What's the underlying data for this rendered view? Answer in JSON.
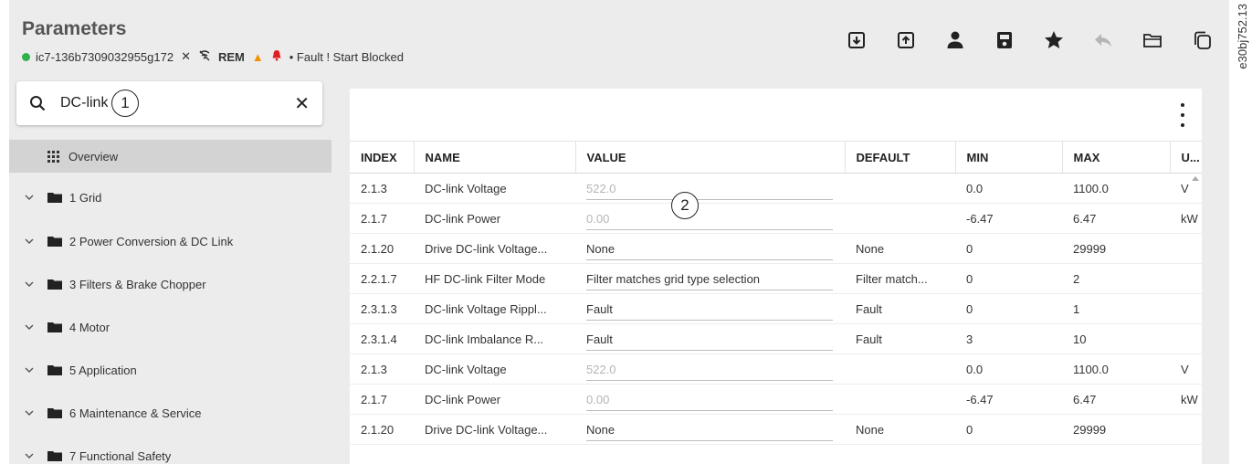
{
  "header": {
    "title": "Parameters",
    "device_id": "ic7-136b7309032955g172",
    "rem_label": "REM",
    "status_text": "• Fault ! Start Blocked",
    "status_color": "#2fb24a"
  },
  "watermark": "e30bj752.13",
  "toolbar": {
    "icons": [
      "download-icon",
      "upload-icon",
      "user-icon",
      "save-icon",
      "star-icon",
      "undo-icon",
      "folder-open-icon",
      "copy-icon"
    ]
  },
  "search": {
    "value": "DC-link",
    "callout": "1"
  },
  "sidebar": {
    "overview": "Overview",
    "items": [
      {
        "label": "1 Grid"
      },
      {
        "label": "2 Power Conversion & DC Link"
      },
      {
        "label": "3 Filters & Brake Chopper"
      },
      {
        "label": "4 Motor"
      },
      {
        "label": "5 Application"
      },
      {
        "label": "6 Maintenance & Service"
      },
      {
        "label": "7 Functional Safety"
      }
    ]
  },
  "table": {
    "callout": "2",
    "columns": [
      "INDEX",
      "NAME",
      "VALUE",
      "DEFAULT",
      "MIN",
      "MAX",
      "U..."
    ],
    "rows": [
      {
        "index": "2.1.3",
        "name": "DC-link Voltage",
        "value": "522.0",
        "muted": true,
        "default": "",
        "min": "0.0",
        "max": "1100.0",
        "unit": "V"
      },
      {
        "index": "2.1.7",
        "name": "DC-link Power",
        "value": "0.00",
        "muted": true,
        "default": "",
        "min": "-6.47",
        "max": "6.47",
        "unit": "kW"
      },
      {
        "index": "2.1.20",
        "name": "Drive DC-link Voltage...",
        "value": "None",
        "muted": false,
        "default": "None",
        "min": "0",
        "max": "29999",
        "unit": ""
      },
      {
        "index": "2.2.1.7",
        "name": "HF DC-link Filter Mode",
        "value": "Filter matches grid type selection",
        "muted": false,
        "default": "Filter match...",
        "min": "0",
        "max": "2",
        "unit": ""
      },
      {
        "index": "2.3.1.3",
        "name": "DC-link Voltage Rippl...",
        "value": "Fault",
        "muted": false,
        "default": "Fault",
        "min": "0",
        "max": "1",
        "unit": ""
      },
      {
        "index": "2.3.1.4",
        "name": "DC-link Imbalance R...",
        "value": "Fault",
        "muted": false,
        "default": "Fault",
        "min": "3",
        "max": "10",
        "unit": ""
      },
      {
        "index": "2.1.3",
        "name": "DC-link Voltage",
        "value": "522.0",
        "muted": true,
        "default": "",
        "min": "0.0",
        "max": "1100.0",
        "unit": "V"
      },
      {
        "index": "2.1.7",
        "name": "DC-link Power",
        "value": "0.00",
        "muted": true,
        "default": "",
        "min": "-6.47",
        "max": "6.47",
        "unit": "kW"
      },
      {
        "index": "2.1.20",
        "name": "Drive DC-link Voltage...",
        "value": "None",
        "muted": false,
        "default": "None",
        "min": "0",
        "max": "29999",
        "unit": ""
      }
    ]
  }
}
